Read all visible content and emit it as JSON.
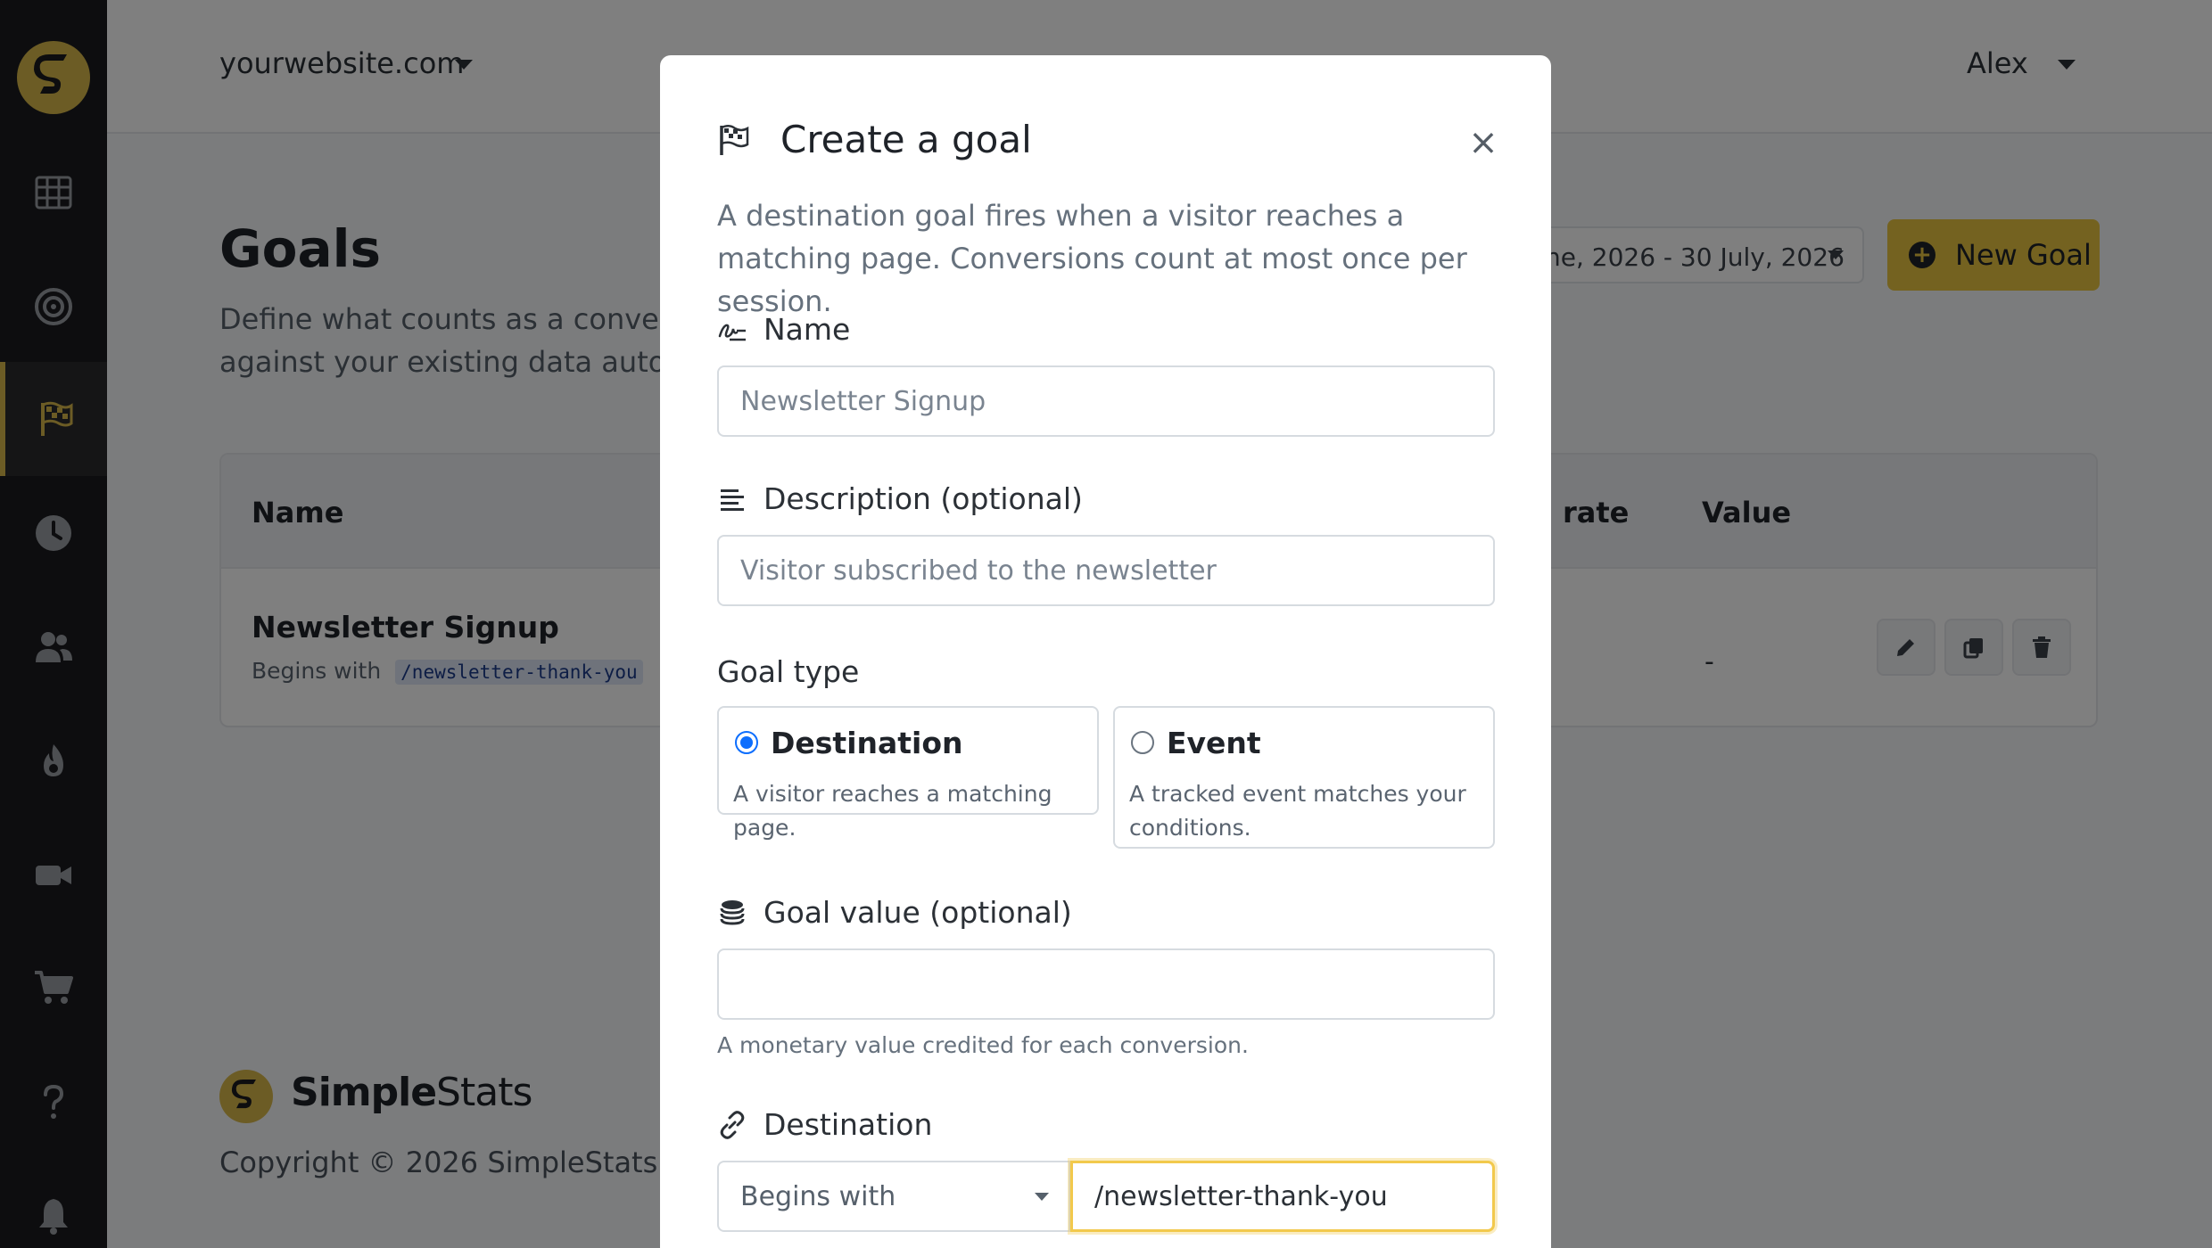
{
  "header": {
    "site": "yourwebsite.com",
    "user": "Alex"
  },
  "sidebar": {
    "items": [
      {
        "icon": "grid-icon"
      },
      {
        "icon": "target-icon"
      },
      {
        "icon": "flag-icon",
        "active": true
      },
      {
        "icon": "clock-icon"
      },
      {
        "icon": "users-icon"
      },
      {
        "icon": "fire-icon"
      },
      {
        "icon": "video-icon"
      },
      {
        "icon": "cart-icon"
      },
      {
        "icon": "help-icon"
      },
      {
        "icon": "bell-icon"
      }
    ]
  },
  "page": {
    "title": "Goals",
    "subtitle_line1": "Define what counts as a conversion",
    "subtitle_line2": "against your existing data automati",
    "date_range": "ne, 2026 - 30 July, 2026",
    "new_goal_label": "New Goal",
    "table": {
      "headers": {
        "name": "Name",
        "rate": "rate",
        "value": "Value"
      },
      "rows": [
        {
          "name": "Newsletter Signup",
          "rule": "Begins with",
          "path": "/newsletter-thank-you",
          "value": "-"
        }
      ]
    },
    "footer": {
      "brand_bold": "Simple",
      "brand_rest": "Stats",
      "copyright": "Copyright © 2026 SimpleStats."
    }
  },
  "modal": {
    "title": "Create a goal",
    "close": "×",
    "description": "A destination goal fires when a visitor reaches a matching page. Conversions count at most once per session.",
    "name_label": "Name",
    "name_placeholder": "Newsletter Signup",
    "description_label": "Description (optional)",
    "description_placeholder": "Visitor subscribed to the newsletter",
    "goal_type_label": "Goal type",
    "goal_types": [
      {
        "title": "Destination",
        "desc": "A visitor reaches a matching page.",
        "checked": true
      },
      {
        "title": "Event",
        "desc_line1": "A tracked event matches your",
        "desc_line2": "conditions.",
        "checked": false
      }
    ],
    "value_label": "Goal value (optional)",
    "value_input": "",
    "value_help": "A monetary value credited for each conversion.",
    "destination_label": "Destination",
    "match_select": "Begins with",
    "destination_value": "/newsletter-thank-you"
  },
  "colors": {
    "accent": "#e8c440",
    "sidebar_bg": "#1a1b1f",
    "radio_checked": "#0d6efd"
  }
}
